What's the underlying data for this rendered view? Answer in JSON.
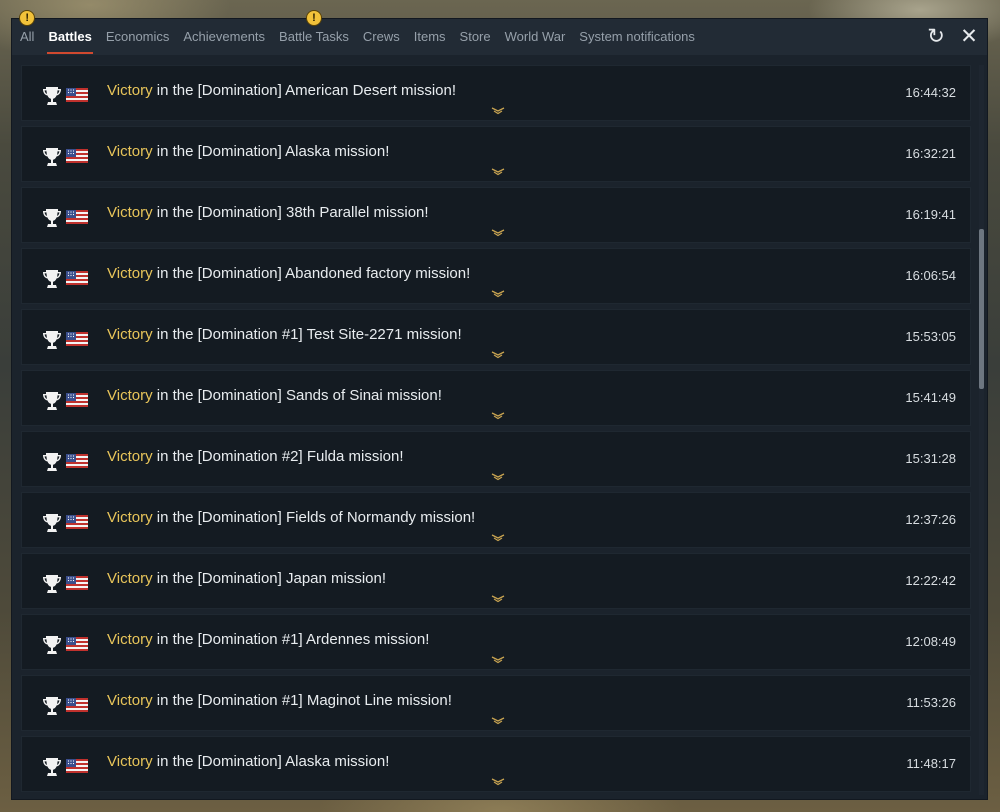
{
  "tabs": [
    {
      "label": "All",
      "warning": true
    },
    {
      "label": "Battles",
      "active": true
    },
    {
      "label": "Economics"
    },
    {
      "label": "Achievements"
    },
    {
      "label": "Battle Tasks",
      "warning": true
    },
    {
      "label": "Crews"
    },
    {
      "label": "Items"
    },
    {
      "label": "Store"
    },
    {
      "label": "World War"
    },
    {
      "label": "System notifications"
    }
  ],
  "warning_glyph": "!",
  "controls": {
    "refresh_glyph": "↻",
    "close_glyph": "✕"
  },
  "rows": [
    {
      "victory": "Victory",
      "text": " in the [Domination] American Desert mission!",
      "time": "16:44:32"
    },
    {
      "victory": "Victory",
      "text": " in the [Domination] Alaska mission!",
      "time": "16:32:21"
    },
    {
      "victory": "Victory",
      "text": " in the [Domination] 38th Parallel mission!",
      "time": "16:19:41"
    },
    {
      "victory": "Victory",
      "text": " in the [Domination] Abandoned factory mission!",
      "time": "16:06:54"
    },
    {
      "victory": "Victory",
      "text": " in the [Domination #1] Test Site-2271 mission!",
      "time": "15:53:05"
    },
    {
      "victory": "Victory",
      "text": " in the [Domination] Sands of Sinai mission!",
      "time": "15:41:49"
    },
    {
      "victory": "Victory",
      "text": " in the [Domination #2] Fulda mission!",
      "time": "15:31:28"
    },
    {
      "victory": "Victory",
      "text": " in the [Domination] Fields of Normandy mission!",
      "time": "12:37:26"
    },
    {
      "victory": "Victory",
      "text": " in the [Domination] Japan mission!",
      "time": "12:22:42"
    },
    {
      "victory": "Victory",
      "text": " in the [Domination #1] Ardennes mission!",
      "time": "12:08:49"
    },
    {
      "victory": "Victory",
      "text": " in the [Domination #1] Maginot Line mission!",
      "time": "11:53:26"
    },
    {
      "victory": "Victory",
      "text": " in the [Domination] Alaska mission!",
      "time": "11:48:17"
    }
  ],
  "icons": {
    "trophy": "trophy-icon",
    "flag": "usa-flag-icon",
    "expand": "chevron-down-icon"
  },
  "colors": {
    "accent": "#d0492f",
    "victory": "#e8c55a",
    "warning": "#f2c23a",
    "panel": "#1b232c",
    "row": "#141b22"
  }
}
